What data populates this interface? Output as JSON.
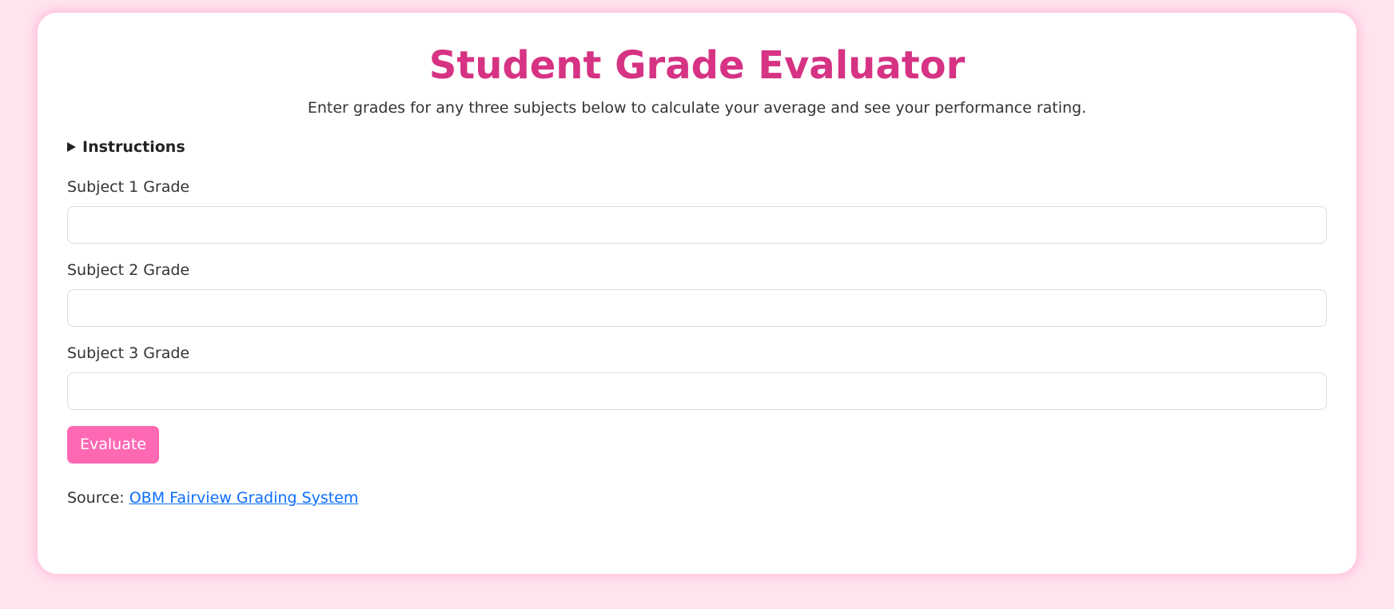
{
  "page": {
    "title": "Student Grade Evaluator",
    "subtitle": "Enter grades for any three subjects below to calculate your average and see your performance rating."
  },
  "instructions": {
    "label": "Instructions"
  },
  "form": {
    "fields": [
      {
        "label": "Subject 1 Grade",
        "value": ""
      },
      {
        "label": "Subject 2 Grade",
        "value": ""
      },
      {
        "label": "Subject 3 Grade",
        "value": ""
      }
    ],
    "submit_label": "Evaluate"
  },
  "source": {
    "prefix": "Source:",
    "link_text": "OBM Fairview Grading System"
  },
  "colors": {
    "background": "#ffe4ef",
    "title": "#d63384",
    "button": "#ff69b4",
    "link": "#0d6efd"
  }
}
